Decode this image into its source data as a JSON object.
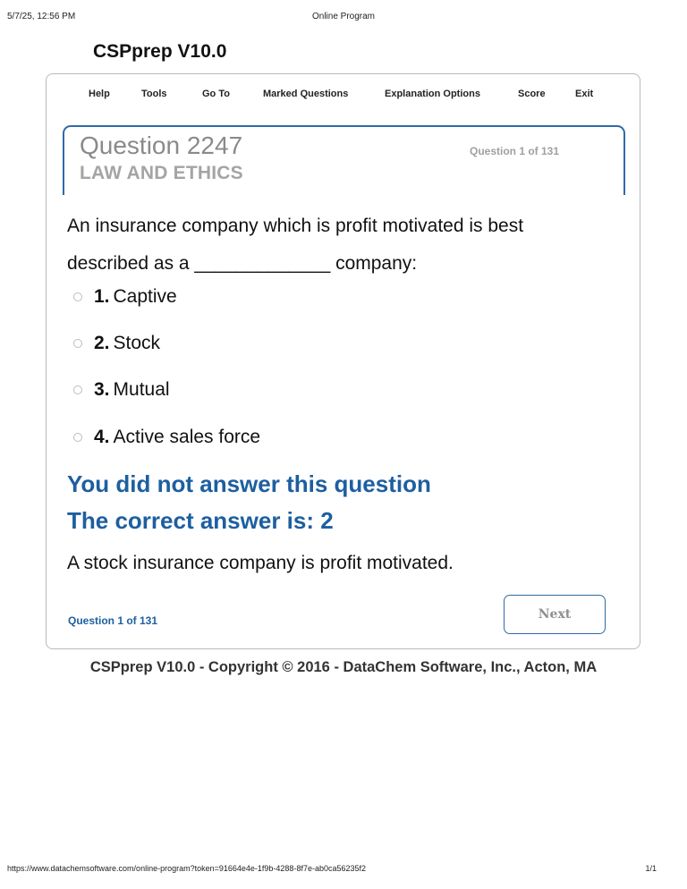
{
  "print_header": {
    "datetime": "5/7/25, 12:56 PM",
    "page_title": "Online Program"
  },
  "app": {
    "title": "CSPprep V10.0"
  },
  "menu": {
    "items": [
      {
        "label": "Help"
      },
      {
        "label": "Tools"
      },
      {
        "label": "Go To"
      },
      {
        "label": "Marked Questions"
      },
      {
        "label": "Explanation Options"
      },
      {
        "label": "Score"
      },
      {
        "label": "Exit"
      }
    ]
  },
  "question": {
    "number": "Question 2247",
    "category": "LAW AND ETHICS",
    "counter": "Question 1 of 131",
    "text_line1": "An insurance company which is profit motivated is best",
    "text_line2": "described as a _____________ company:",
    "options": [
      {
        "num": "1.",
        "label": "Captive"
      },
      {
        "num": "2.",
        "label": "Stock"
      },
      {
        "num": "3.",
        "label": "Mutual"
      },
      {
        "num": "4.",
        "label": "Active sales force"
      }
    ]
  },
  "result": {
    "status": "You did not answer this question",
    "correct": "The correct answer is: 2",
    "explanation": "A stock insurance company is profit motivated."
  },
  "footer_nav": {
    "counter": "Question 1 of 131",
    "next_label": "Next"
  },
  "copyright": "CSPprep V10.0 - Copyright © 2016 - DataChem Software, Inc., Acton, MA",
  "print_footer": {
    "url": "https://www.datachemsoftware.com/online-program?token=91664e4e-1f9b-4288-8f7e-ab0ca56235f2",
    "page": "1/1"
  },
  "colors": {
    "accent": "#1d5fa0",
    "box_border": "#2f6aa7",
    "muted": "#8a8a8a"
  }
}
